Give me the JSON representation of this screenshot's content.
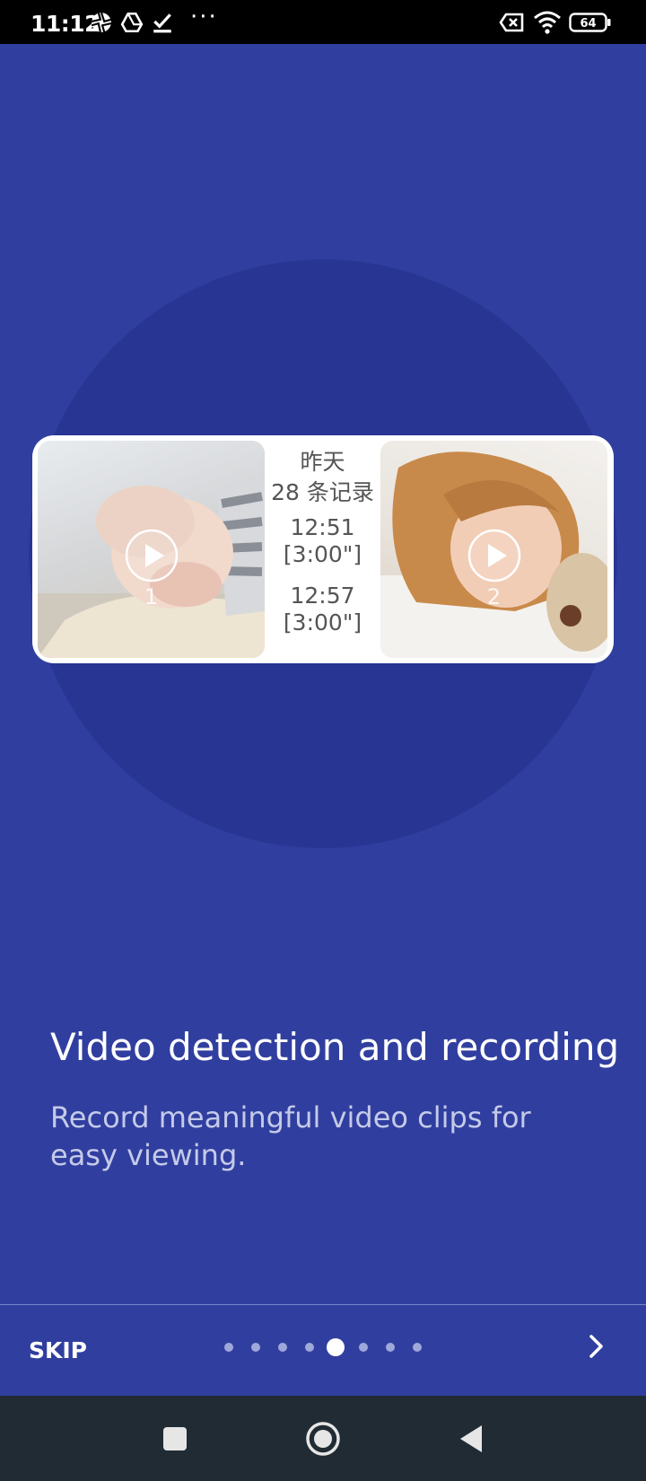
{
  "status_bar": {
    "time": "11:12",
    "battery": "64",
    "icons": [
      "aperture-icon",
      "drive-icon",
      "check-icon",
      "more-dots-icon",
      "no-sim-icon",
      "wifi-icon",
      "battery-icon"
    ]
  },
  "card": {
    "day": "昨天",
    "count": "28 条记录",
    "entries": [
      {
        "time": "12:51",
        "duration": "[3:00\"]"
      },
      {
        "time": "12:57",
        "duration": "[3:00\"]"
      }
    ],
    "thumbs": [
      {
        "number": "1"
      },
      {
        "number": "2"
      }
    ]
  },
  "onboarding": {
    "title": "Video detection and recording",
    "description": "Record meaningful video clips for easy viewing."
  },
  "footer": {
    "skip_label": "SKIP",
    "page_count": 8,
    "active_page": 5
  },
  "colors": {
    "background": "#303f9f",
    "circle": "#283593",
    "navbar": "#212b33"
  }
}
